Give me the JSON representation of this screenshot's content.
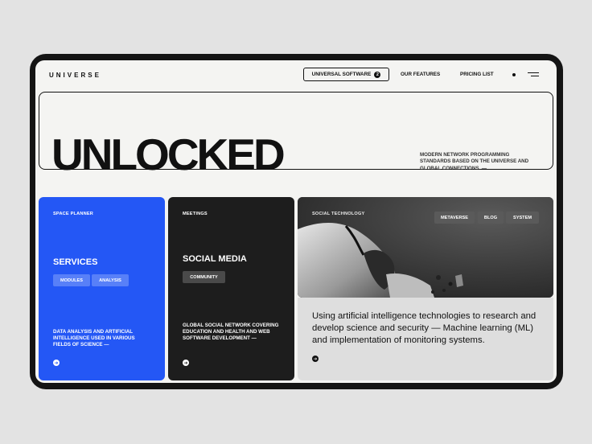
{
  "header": {
    "logo": "UNIVERSE",
    "nav_primary": "UNIVERSAL SOFTWARE",
    "nav_primary_badge": "2",
    "nav_items": [
      "OUR FEATURES",
      "PRICING LIST"
    ]
  },
  "hero": {
    "title": "UNLOCKED",
    "description": "MODERN NETWORK PROGRAMMING STANDARDS BASED ON THE UNIVERSE AND GLOBAL CONNECTIONS. —"
  },
  "cards": {
    "services": {
      "eyebrow": "SPACE PLANNER",
      "title": "SERVICES",
      "tags": [
        "MODULES",
        "ANALYSIS"
      ],
      "description": "DATA ANALYSIS AND ARTIFICIAL INTELLIGENCE USED IN VARIOUS FIELDS OF SCIENCE —",
      "accent": "#2457f5"
    },
    "social": {
      "eyebrow": "MEETINGS",
      "title": "SOCIAL MEDIA",
      "tags": [
        "COMMUNITY"
      ],
      "description": "GLOBAL SOCIAL NETWORK COVERING EDUCATION AND HEALTH AND WEB SOFTWARE DEVELOPMENT —"
    },
    "technology": {
      "eyebrow": "SOCIAL TECHNOLOGY",
      "tags": [
        "METAVERSE",
        "BLOG",
        "SYSTEM"
      ],
      "body": "Using artificial intelligence technologies to research and develop science and security — Machine learning (ML) and implementation of monitoring systems."
    }
  },
  "icons": [
    "menu-icon",
    "arrow-right-icon"
  ]
}
